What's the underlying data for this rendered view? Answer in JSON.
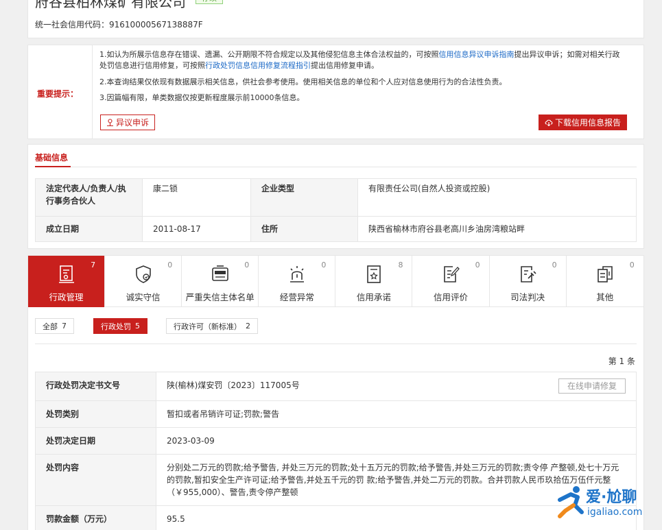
{
  "header": {
    "company_name": "府谷县柏林煤矿有限公司",
    "status_badge": "存续",
    "credit_code_label": "统一社会信用代码：",
    "credit_code": "91610000567138887F"
  },
  "notice": {
    "title": "重要提示：",
    "line1_a": "1.如认为所展示信息存在错误、遗漏、公开期限不符合规定以及其他侵犯信息主体合法权益的，可按照",
    "line1_link": "信用信息异议申诉指南",
    "line1_b": "提出异议申诉；如需对相关行政",
    "line1_c": "处罚信息进行信用修复，可按照",
    "line1_link2": "行政处罚信息信用修复流程指引",
    "line1_d": "提出信用修复申请。",
    "line2": "2.本查询结果仅依现有数据展示相关信息，供社会参考使用。使用相关信息的单位和个人应对信息使用行为的合法性负责。",
    "line3": "3.因篇幅有限，单类数据仅按更新程度展示前10000条信息。",
    "objection_button": "异议申诉",
    "download_button": "下载信用信息报告"
  },
  "basic": {
    "tab_label": "基础信息",
    "rows": [
      {
        "k1": "法定代表人/负责人/执行事务合伙人",
        "v1": "康二锁",
        "k2": "企业类型",
        "v2": "有限责任公司(自然人投资或控股)"
      },
      {
        "k1": "成立日期",
        "v1": "2011-08-17",
        "k2": "住所",
        "v2": "陕西省榆林市府谷县老高川乡油房湾粮站畔"
      }
    ]
  },
  "categories": [
    {
      "label": "行政管理",
      "count": "7",
      "icon": "document-stamp-icon"
    },
    {
      "label": "诚实守信",
      "count": "0",
      "icon": "shield-credit-icon"
    },
    {
      "label": "严重失信主体名单",
      "count": "0",
      "icon": "untrustworthy-list-icon"
    },
    {
      "label": "经营异常",
      "count": "0",
      "icon": "alarm-light-icon"
    },
    {
      "label": "信用承诺",
      "count": "8",
      "icon": "commitment-certificate-icon"
    },
    {
      "label": "信用评价",
      "count": "0",
      "icon": "evaluation-pen-icon"
    },
    {
      "label": "司法判决",
      "count": "0",
      "icon": "judgment-hammer-icon"
    },
    {
      "label": "其他",
      "count": "0",
      "icon": "other-docs-icon"
    }
  ],
  "filters": [
    {
      "label": "全部",
      "count": "7"
    },
    {
      "label": "行政处罚",
      "count": "5"
    },
    {
      "label": "行政许可（新标准）",
      "count": "2"
    }
  ],
  "page_info": "第 1 条",
  "detail": {
    "repair_button": "在线申请修复",
    "rows": [
      {
        "k": "行政处罚决定书文号",
        "v": "陕(榆林)煤安罚〔2023〕117005号"
      },
      {
        "k": "处罚类别",
        "v": "暂扣或者吊销许可证;罚款;警告"
      },
      {
        "k": "处罚决定日期",
        "v": "2023-03-09"
      },
      {
        "k": "处罚内容",
        "v": "分别处二万元的罚款;给予警告, 并处三万元的罚款;处十五万元的罚款;给予警告,并处三万元的罚款;责令停 产整顿,处七十万元的罚款,暂扣安全生产许可证;给予警告,并处五千元的罚 款;给予警告,并处二万元的罚款。合并罚款人民币玖拾伍万伍仟元整 （￥955,000）、警告,责令停产整顿"
      },
      {
        "k": "罚款金额（万元）",
        "v": "95.5"
      }
    ]
  },
  "watermark": {
    "brand": "爱·尬聊",
    "domain": "igaliao.com"
  },
  "colors": {
    "accent": "#c8201d",
    "link": "#1a68c6",
    "status_green": "#5aa53f"
  }
}
